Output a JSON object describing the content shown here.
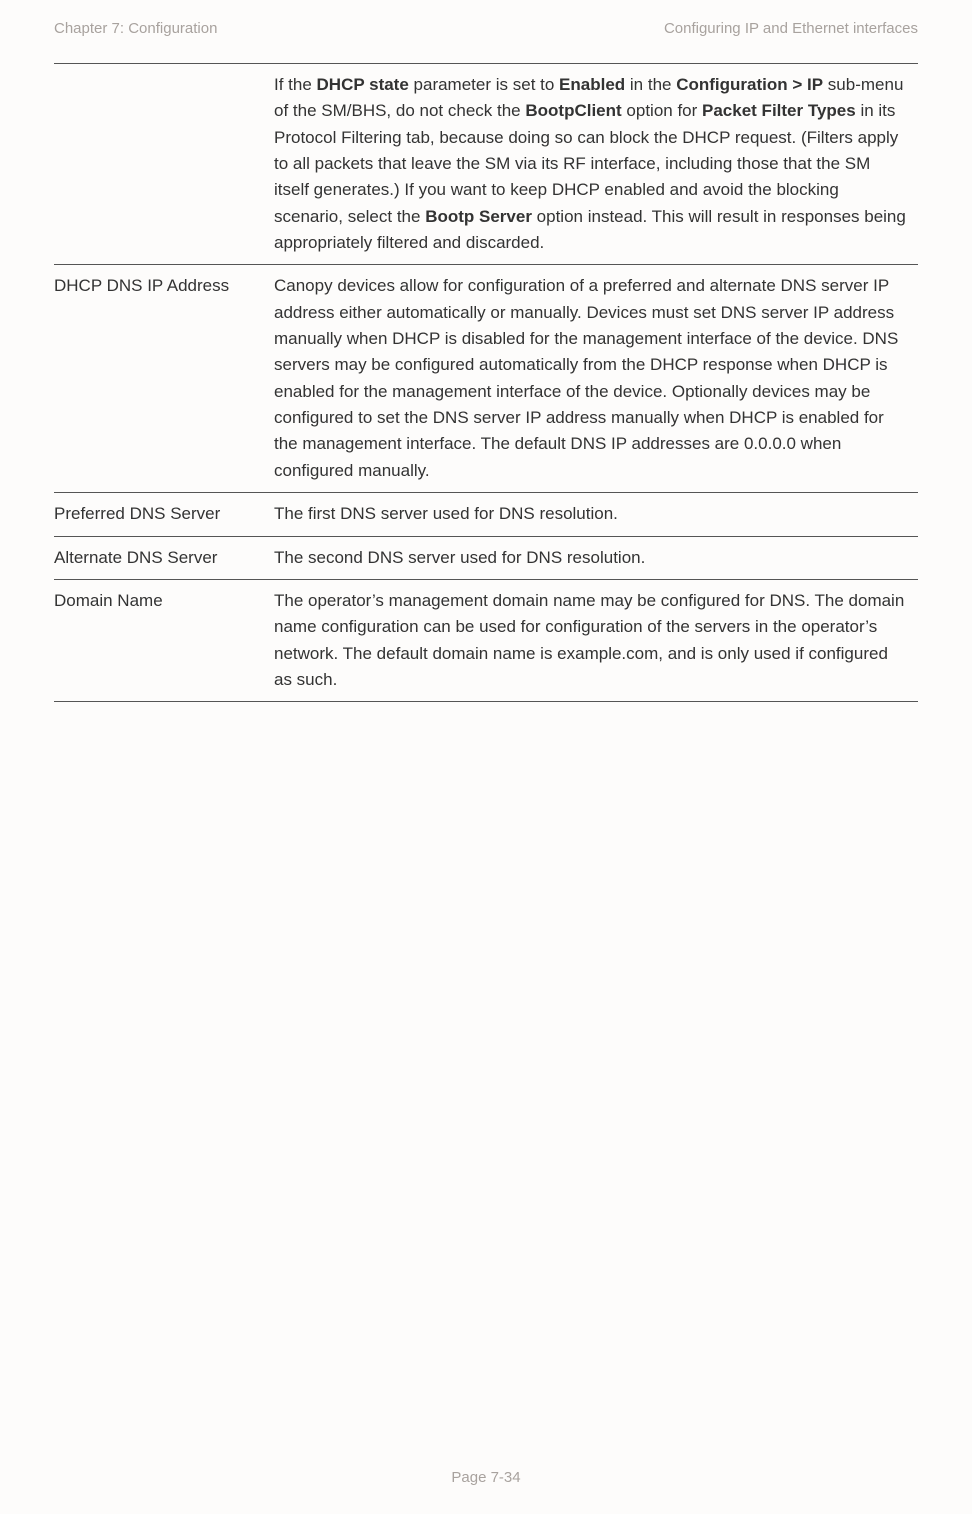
{
  "header": {
    "left": "Chapter 7:  Configuration",
    "right": "Configuring IP and Ethernet interfaces"
  },
  "rows": [
    {
      "label": "",
      "segments": [
        {
          "t": "If the "
        },
        {
          "t": "DHCP state",
          "b": true
        },
        {
          "t": " parameter is set to "
        },
        {
          "t": "Enabled",
          "b": true
        },
        {
          "t": " in the "
        },
        {
          "t": "Configuration > IP",
          "b": true
        },
        {
          "t": " sub-menu of the SM/BHS, do not check the "
        },
        {
          "t": "BootpClient",
          "b": true
        },
        {
          "t": " option for "
        },
        {
          "t": "Packet Filter Types",
          "b": true
        },
        {
          "t": " in its Protocol Filtering tab, because doing so can block the DHCP request. (Filters apply to all packets that leave the SM via its RF interface, including those that the SM itself generates.) If you want to keep DHCP enabled and avoid the blocking scenario, select the "
        },
        {
          "t": "Bootp Server",
          "b": true
        },
        {
          "t": " option instead. This will result in responses being appropriately filtered and discarded."
        }
      ]
    },
    {
      "label": "DHCP DNS IP Address",
      "segments": [
        {
          "t": "Canopy devices allow for configuration of a preferred and alternate DNS server IP address either automatically or manually. Devices must set DNS server IP address manually when DHCP is disabled for the management interface of the device. DNS servers may be configured automatically from the DHCP response when DHCP is enabled for the management interface of the device. Optionally devices may be configured to set the DNS server IP address manually when DHCP is enabled for the management interface. The default DNS IP addresses are 0.0.0.0 when configured manually."
        }
      ]
    },
    {
      "label": "Preferred DNS Server",
      "segments": [
        {
          "t": "The first DNS server used for DNS resolution."
        }
      ]
    },
    {
      "label": "Alternate DNS Server",
      "segments": [
        {
          "t": "The second DNS server used for DNS resolution."
        }
      ]
    },
    {
      "label": "Domain Name",
      "segments": [
        {
          "t": "The operator’s management domain name may be configured for DNS. The domain name configuration can be used for configuration of the servers in the operator’s network. The default domain name is example.com, and is only used if configured as such."
        }
      ]
    }
  ],
  "footer": "Page 7-34"
}
